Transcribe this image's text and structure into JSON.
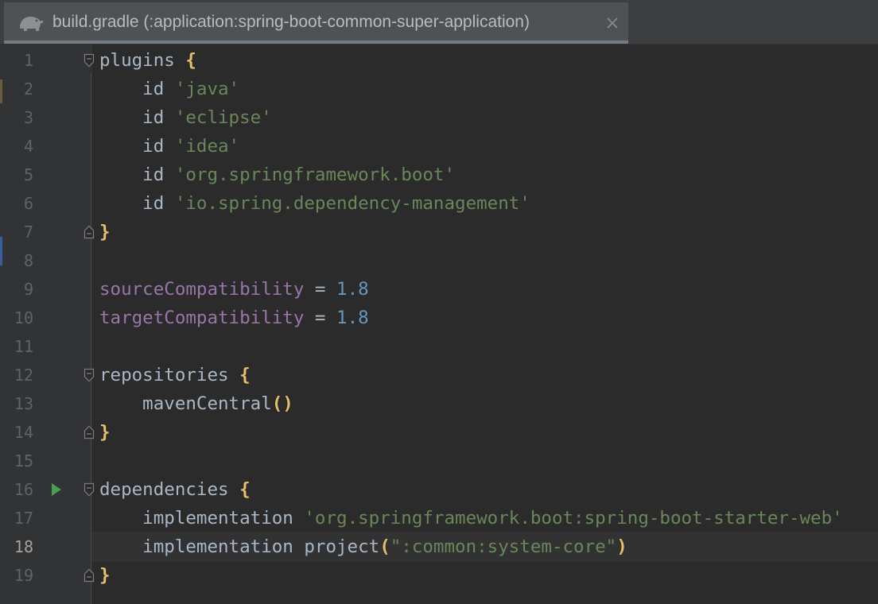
{
  "tab": {
    "icon": "gradle-elephant-icon",
    "title": "build.gradle (:application:spring-boot-common-super-application)",
    "close_icon": "close-icon"
  },
  "colors": {
    "background": "#2b2b2b",
    "gutter": "#313335",
    "default_text": "#a9b7c6",
    "string": "#6a8759",
    "number": "#6897bb",
    "property": "#9876aa",
    "brace": "#e8bf6a",
    "run_arrow": "#499c54"
  },
  "editor": {
    "current_line": 18,
    "lines": [
      {
        "n": "1",
        "fold": "open",
        "tokens": [
          {
            "t": "plugins ",
            "c": ""
          },
          {
            "t": "{",
            "c": "brace"
          }
        ]
      },
      {
        "n": "2",
        "tokens": [
          {
            "t": "    id ",
            "c": ""
          },
          {
            "t": "'java'",
            "c": "str"
          }
        ]
      },
      {
        "n": "3",
        "tokens": [
          {
            "t": "    id ",
            "c": ""
          },
          {
            "t": "'eclipse'",
            "c": "str"
          }
        ]
      },
      {
        "n": "4",
        "tokens": [
          {
            "t": "    id ",
            "c": ""
          },
          {
            "t": "'idea'",
            "c": "str"
          }
        ]
      },
      {
        "n": "5",
        "tokens": [
          {
            "t": "    id ",
            "c": ""
          },
          {
            "t": "'org.springframework.boot'",
            "c": "str"
          }
        ]
      },
      {
        "n": "6",
        "tokens": [
          {
            "t": "    id ",
            "c": ""
          },
          {
            "t": "'io.spring.dependency-management'",
            "c": "str"
          }
        ]
      },
      {
        "n": "7",
        "fold": "close",
        "tokens": [
          {
            "t": "}",
            "c": "brace"
          }
        ]
      },
      {
        "n": "8",
        "tokens": []
      },
      {
        "n": "9",
        "tokens": [
          {
            "t": "sourceCompatibility",
            "c": "prop"
          },
          {
            "t": " = ",
            "c": ""
          },
          {
            "t": "1.8",
            "c": "num"
          }
        ]
      },
      {
        "n": "10",
        "tokens": [
          {
            "t": "targetCompatibility",
            "c": "prop"
          },
          {
            "t": " = ",
            "c": ""
          },
          {
            "t": "1.8",
            "c": "num"
          }
        ]
      },
      {
        "n": "11",
        "tokens": []
      },
      {
        "n": "12",
        "fold": "open",
        "tokens": [
          {
            "t": "repositories ",
            "c": ""
          },
          {
            "t": "{",
            "c": "brace"
          }
        ]
      },
      {
        "n": "13",
        "tokens": [
          {
            "t": "    mavenCentral",
            "c": ""
          },
          {
            "t": "()",
            "c": "brace"
          }
        ]
      },
      {
        "n": "14",
        "fold": "close",
        "tokens": [
          {
            "t": "}",
            "c": "brace"
          }
        ]
      },
      {
        "n": "15",
        "tokens": []
      },
      {
        "n": "16",
        "fold": "open",
        "run": true,
        "tokens": [
          {
            "t": "dependencies ",
            "c": ""
          },
          {
            "t": "{",
            "c": "brace"
          }
        ]
      },
      {
        "n": "17",
        "tokens": [
          {
            "t": "    implementation ",
            "c": ""
          },
          {
            "t": "'org.springframework.boot:spring-boot-starter-web'",
            "c": "str"
          }
        ]
      },
      {
        "n": "18",
        "tokens": [
          {
            "t": "    implementation project",
            "c": ""
          },
          {
            "t": "(",
            "c": "brace"
          },
          {
            "t": "\":common:system-core\"",
            "c": "str"
          },
          {
            "t": ")",
            "c": "brace"
          }
        ]
      },
      {
        "n": "19",
        "fold": "close",
        "tokens": [
          {
            "t": "}",
            "c": "brace"
          }
        ]
      }
    ]
  }
}
